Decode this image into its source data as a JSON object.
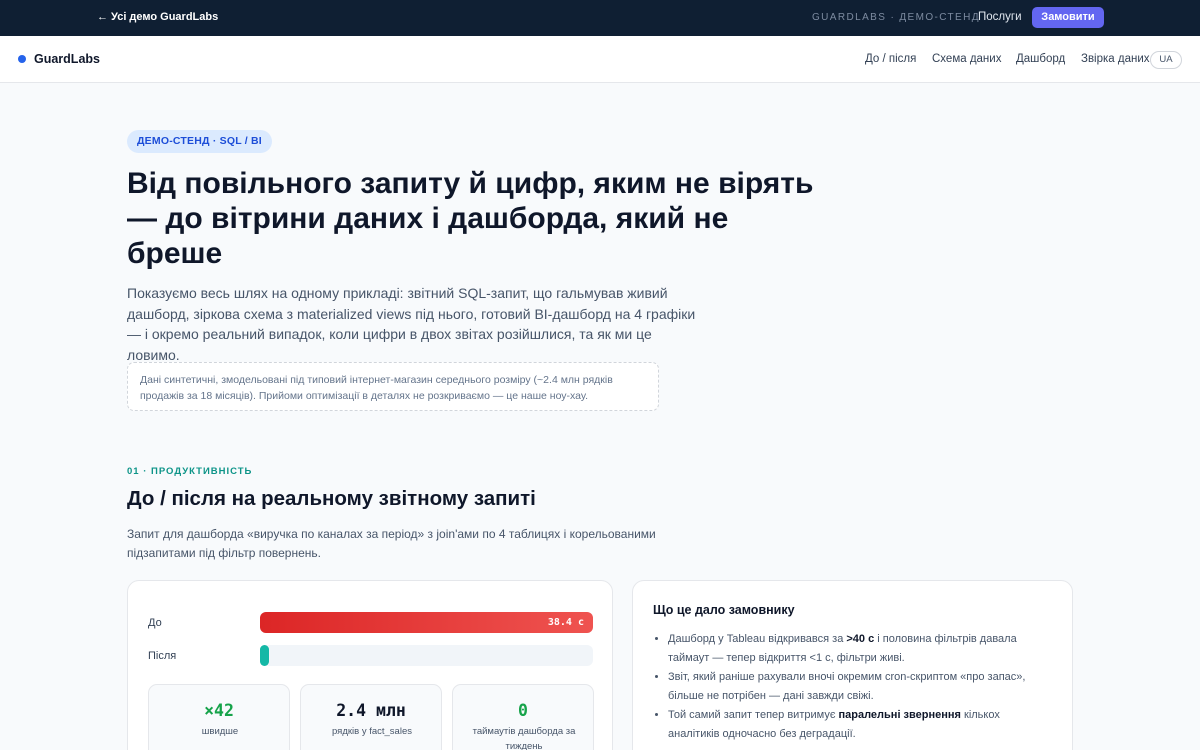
{
  "topbar": {
    "back_link": "← Усі демо GuardLabs",
    "demo_tag": "GUARDLABS · ДЕМО-СТЕНД",
    "services": "Послуги",
    "order_button": "Замовити"
  },
  "navbar": {
    "brand": "GuardLabs",
    "items": [
      "До / після",
      "Схема даних",
      "Дашборд",
      "Звірка даних"
    ],
    "lang": "UA"
  },
  "hero": {
    "badge": "ДЕМО-СТЕНД · SQL / BI",
    "title": "Від повільного запиту й цифр, яким не вірять — до вітрини даних і дашборда, який не бреше",
    "subtitle": "Показуємо весь шлях на одному прикладі: звітний SQL-запит, що гальмував живий дашборд, зіркова схема з materialized views під нього, готовий BI-дашборд на 4 графіки — і окремо реальний випадок, коли цифри в двох звітах розійшлися, та як ми це ловимо.",
    "note": "Дані синтетичні, змодельовані під типовий інтернет-магазин середнього розміру (~2.4 млн рядків продажів за 18 місяців). Прийоми оптимізації в деталях не розкриваємо — це наше ноу-хау."
  },
  "section": {
    "eyebrow": "01 · ПРОДУКТИВНІСТЬ",
    "title": "До / після на реальному звітному запиті",
    "description": "Запит для дашборда «виручка по каналах за період» з join'ами по 4 таблицях і корельованими підзапитами під фільтр повернень."
  },
  "performance": {
    "before_label": "До",
    "after_label": "Після",
    "before_value": "38.4 с",
    "before_fraction": 1.0,
    "after_fraction": 0.026,
    "colors": {
      "before": "#dc2626",
      "after": "#14b8a6"
    },
    "stats": [
      {
        "value": "×42",
        "label": "швидше",
        "color": "#16a34a"
      },
      {
        "value": "2.4 млн",
        "label": "рядків у fact_sales",
        "color": "#0f172a"
      },
      {
        "value": "0",
        "label": "таймаутів дашборда за тиждень",
        "color": "#16a34a"
      }
    ]
  },
  "result": {
    "title": "Що це дало замовнику",
    "items": [
      {
        "pre": "Дашборд у Tableau відкривався за ",
        "bold": ">40 с",
        "post": " і половина фільтрів давала таймаут — тепер відкриття <1 с, фільтри живі."
      },
      {
        "pre": "Звіт, який раніше рахували вночі окремим cron-скриптом «про запас», більше не потрібен — дані завжди свіжі.",
        "bold": "",
        "post": ""
      },
      {
        "pre": "Той самий запит тепер витримує ",
        "bold": "паралельні звернення",
        "post": " кількох аналітиків одночасно без деградації."
      }
    ]
  }
}
